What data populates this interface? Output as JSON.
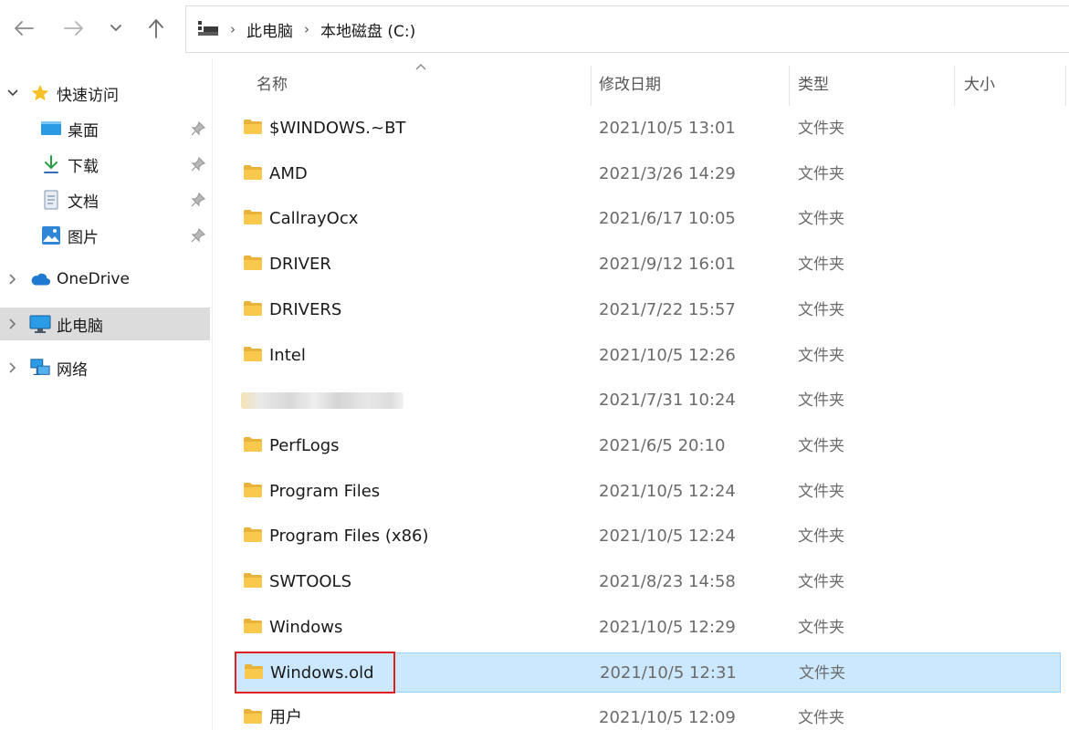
{
  "nav": {
    "back_icon": "arrow-left-icon",
    "forward_icon": "arrow-right-icon",
    "recent_icon": "chevron-down-icon",
    "up_icon": "arrow-up-icon"
  },
  "address": {
    "icon": "this-pc-icon",
    "crumbs": [
      "此电脑",
      "本地磁盘 (C:)"
    ]
  },
  "sidebar": {
    "quick_access": {
      "label": "快速访问",
      "icon": "star-icon"
    },
    "pinned": [
      {
        "label": "桌面",
        "icon": "desktop-icon"
      },
      {
        "label": "下载",
        "icon": "download-icon"
      },
      {
        "label": "文档",
        "icon": "document-icon"
      },
      {
        "label": "图片",
        "icon": "pictures-icon"
      }
    ],
    "onedrive": {
      "label": "OneDrive",
      "icon": "cloud-icon"
    },
    "this_pc": {
      "label": "此电脑",
      "icon": "monitor-icon"
    },
    "network": {
      "label": "网络",
      "icon": "network-icon"
    }
  },
  "columns": {
    "name": "名称",
    "modified": "修改日期",
    "type": "类型",
    "size": "大小"
  },
  "files": [
    {
      "name": "$WINDOWS.~BT",
      "modified": "2021/10/5 13:01",
      "type": "文件夹"
    },
    {
      "name": "AMD",
      "modified": "2021/3/26 14:29",
      "type": "文件夹"
    },
    {
      "name": "CallrayOcx",
      "modified": "2021/6/17 10:05",
      "type": "文件夹"
    },
    {
      "name": "DRIVER",
      "modified": "2021/9/12 16:01",
      "type": "文件夹"
    },
    {
      "name": "DRIVERS",
      "modified": "2021/7/22 15:57",
      "type": "文件夹"
    },
    {
      "name": "Intel",
      "modified": "2021/10/5 12:26",
      "type": "文件夹"
    },
    {
      "name": "",
      "modified": "2021/7/31 10:24",
      "type": "文件夹"
    },
    {
      "name": "PerfLogs",
      "modified": "2021/6/5 20:10",
      "type": "文件夹"
    },
    {
      "name": "Program Files",
      "modified": "2021/10/5 12:24",
      "type": "文件夹"
    },
    {
      "name": "Program Files (x86)",
      "modified": "2021/10/5 12:24",
      "type": "文件夹"
    },
    {
      "name": "SWTOOLS",
      "modified": "2021/8/23 14:58",
      "type": "文件夹"
    },
    {
      "name": "Windows",
      "modified": "2021/10/5 12:29",
      "type": "文件夹"
    },
    {
      "name": "Windows.old",
      "modified": "2021/10/5 12:31",
      "type": "文件夹"
    },
    {
      "name": "用户",
      "modified": "2021/10/5 12:09",
      "type": "文件夹"
    }
  ],
  "colors": {
    "selection_bg": "#cce8ff",
    "selection_border": "#99d1ff",
    "highlight_box": "#e02020",
    "folder": "#f8c94c"
  }
}
